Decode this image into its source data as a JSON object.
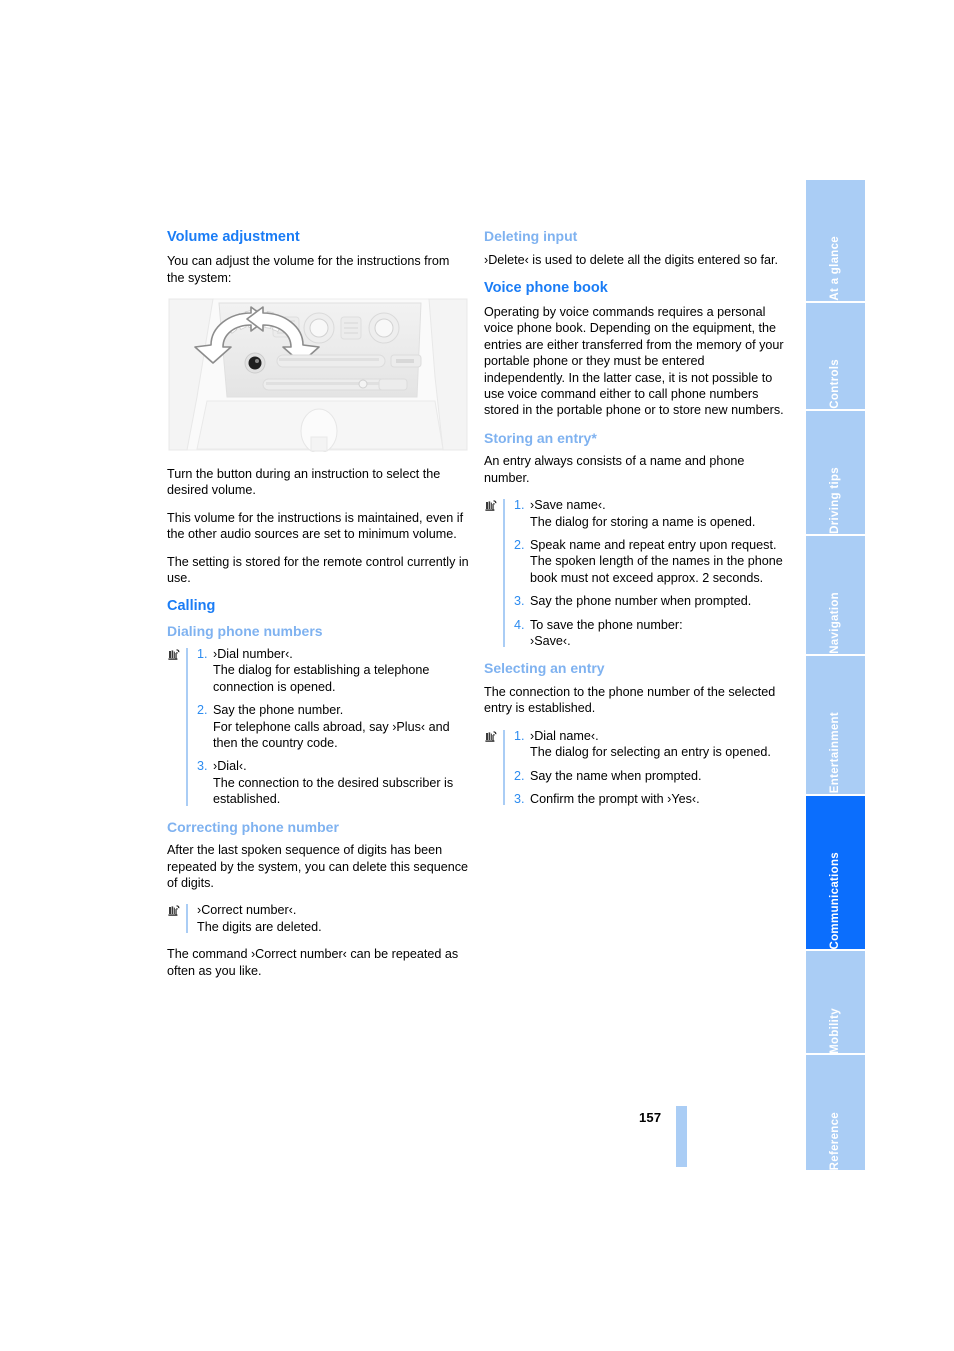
{
  "page": {
    "number": "157"
  },
  "sidebar": {
    "tabs": [
      {
        "label": "At a glance",
        "active": false
      },
      {
        "label": "Controls",
        "active": false
      },
      {
        "label": "Driving tips",
        "active": false
      },
      {
        "label": "Navigation",
        "active": false
      },
      {
        "label": "Entertainment",
        "active": false
      },
      {
        "label": "Communications",
        "active": true
      },
      {
        "label": "Mobility",
        "active": false
      },
      {
        "label": "Reference",
        "active": false
      }
    ],
    "active_color": "#0b6efd",
    "inactive_color": "#aacdf5"
  },
  "left_column": {
    "volume": {
      "heading": "Volume adjustment",
      "intro": "You can adjust the volume for the instructions from the system:",
      "figure_name": "center-console-volume-knob-illustration",
      "figure_credit": "",
      "after_1": "Turn the button during an instruction to select the desired volume.",
      "after_2": "This volume for the instructions is maintained, even if the other audio sources are set to minimum volume.",
      "after_3": "The setting is stored for the remote control currently in use."
    },
    "calling": {
      "heading": "Calling",
      "dialing": {
        "subheading": "Dialing phone numbers",
        "steps": [
          {
            "num": "1.",
            "text": "›Dial number‹.\nThe dialog for establishing a telephone connection is opened."
          },
          {
            "num": "2.",
            "text": "Say the phone number.\nFor telephone calls abroad, say ›Plus‹ and then the country code."
          },
          {
            "num": "3.",
            "text": "›Dial‹.\nThe connection to the desired subscriber is established."
          }
        ]
      },
      "correcting": {
        "subheading": "Correcting phone number",
        "intro": "After the last spoken sequence of digits has been repeated by the system, you can delete this sequence of digits.",
        "command": "›Correct number‹.\nThe digits are deleted.",
        "outro": "The command ›Correct number‹ can be repeated as often as you like."
      }
    }
  },
  "right_column": {
    "deleting": {
      "heading": "Deleting input",
      "body": "›Delete‹ is used to delete all the digits entered so far."
    },
    "phonebook": {
      "heading": "Voice phone book",
      "body": "Operating by voice commands requires a personal voice phone book. Depending on the equipment, the entries are either transferred from the memory of your portable phone or they must be entered independently. In the latter case, it is not possible to use voice command either to call phone numbers stored in the portable phone or to store new numbers."
    },
    "storing": {
      "heading": "Storing an entry*",
      "intro": "An entry always consists of a name and phone number.",
      "steps": [
        {
          "num": "1.",
          "text": "›Save name‹.\nThe dialog for storing a name is opened."
        },
        {
          "num": "2.",
          "text": "Speak name and repeat entry upon request.\nThe spoken length of the names in the phone book must not exceed approx. 2 seconds."
        },
        {
          "num": "3.",
          "text": "Say the phone number when prompted."
        },
        {
          "num": "4.",
          "text": "To save the phone number:\n›Save‹."
        }
      ]
    },
    "selecting": {
      "heading": "Selecting an entry",
      "intro": "The connection to the phone number of the selected entry is established.",
      "steps": [
        {
          "num": "1.",
          "text": "›Dial name‹.\nThe dialog for selecting an entry is opened."
        },
        {
          "num": "2.",
          "text": "Say the name when prompted."
        },
        {
          "num": "3.",
          "text": "Confirm the prompt with ›Yes‹."
        }
      ]
    }
  },
  "icons": {
    "voice_command": "voice-command-icon"
  }
}
